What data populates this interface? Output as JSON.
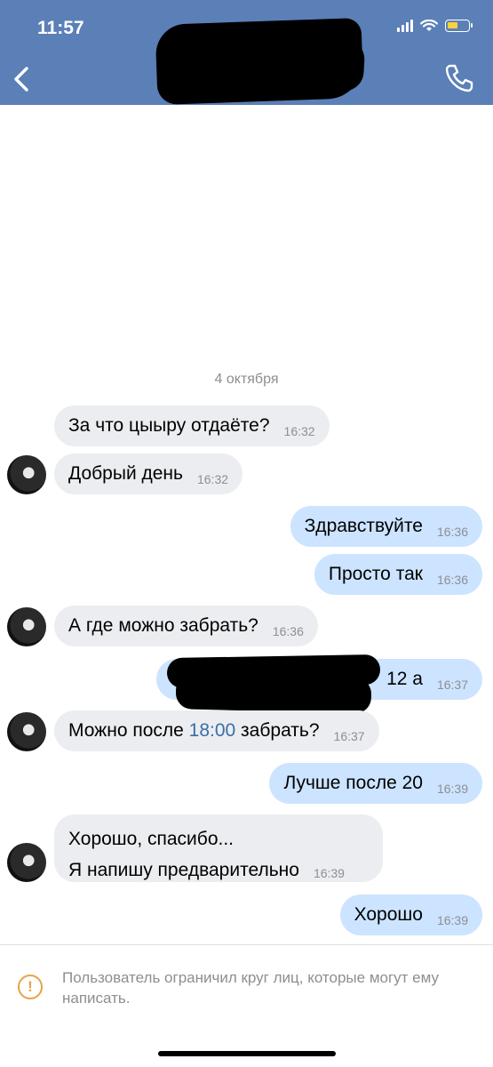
{
  "status_bar": {
    "time": "11:57"
  },
  "header": {
    "back_icon": "chevron-left-icon",
    "call_icon": "phone-icon"
  },
  "date_separator": "4 октября",
  "messages": [
    {
      "dir": "in",
      "text": "За что цыыру отдаёте?",
      "time": "16:32"
    },
    {
      "dir": "in",
      "text": "Добрый день",
      "time": "16:32"
    },
    {
      "dir": "out",
      "text": "Здравствуйте",
      "time": "16:36"
    },
    {
      "dir": "out",
      "text": "Просто так",
      "time": "16:36"
    },
    {
      "dir": "in",
      "text": "А где можно забрать?",
      "time": "16:36"
    },
    {
      "dir": "out",
      "text": "12 а",
      "time": "16:37"
    },
    {
      "dir": "in",
      "text_before": "Можно после ",
      "link": "18:00",
      "text_after": " забрать?",
      "time": "16:37"
    },
    {
      "dir": "out",
      "text": "Лучше после 20",
      "time": "16:39"
    },
    {
      "dir": "in",
      "line1": "Хорошо, спасибо...",
      "line2": "Я напишу предварительно",
      "time": "16:39"
    },
    {
      "dir": "out",
      "text": "Хорошо",
      "time": "16:39"
    }
  ],
  "footer": {
    "warning_icon": "exclamation-circle-icon",
    "notice": "Пользователь ограничил круг лиц, которые могут ему написать."
  },
  "colors": {
    "header": "#5b7fb7",
    "incoming_bubble": "#ebedf0",
    "outgoing_bubble": "#cce4ff",
    "link": "#3a6ea8",
    "warning": "#e8a24a"
  }
}
